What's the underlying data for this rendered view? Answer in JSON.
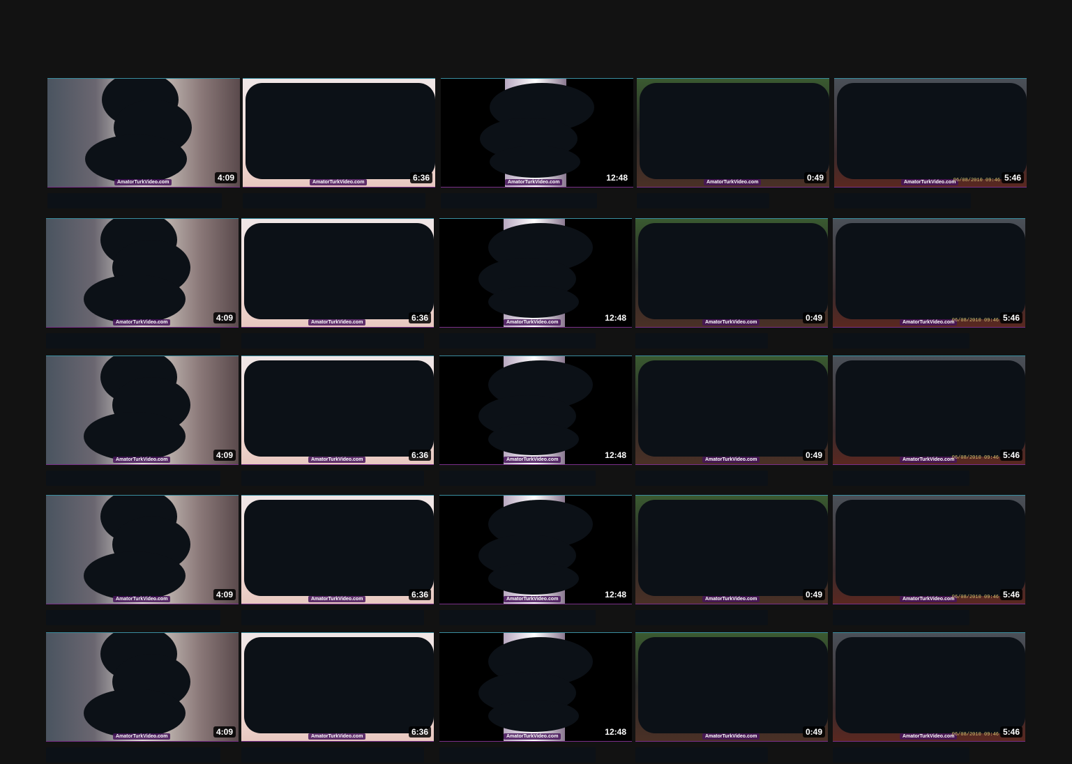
{
  "watermark": "AmatorTurkVideo.com",
  "datestamp": "06/08/2010 09:46",
  "colors": {
    "background": "#121212",
    "redaction": "#0c1117",
    "duration_badge": "#000000",
    "watermark_bg": "#46145a"
  },
  "columns": [
    {
      "duration": "4:09"
    },
    {
      "duration": "6:36"
    },
    {
      "duration": "12:48"
    },
    {
      "duration": "0:49"
    },
    {
      "duration": "5:46"
    }
  ],
  "rows": 5
}
